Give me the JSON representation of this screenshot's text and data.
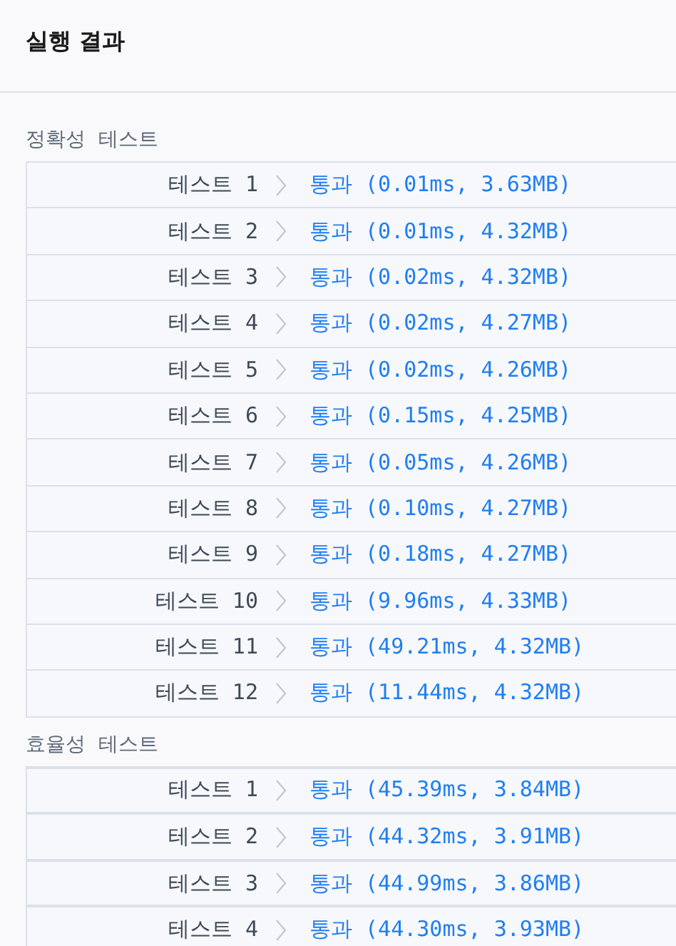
{
  "title": "실행 결과",
  "sections": [
    {
      "label": "정확성  테스트",
      "rows": [
        {
          "label": "테스트 1",
          "result": "통과 (0.01ms, 3.63MB)"
        },
        {
          "label": "테스트 2",
          "result": "통과 (0.01ms, 4.32MB)"
        },
        {
          "label": "테스트 3",
          "result": "통과 (0.02ms, 4.32MB)"
        },
        {
          "label": "테스트 4",
          "result": "통과 (0.02ms, 4.27MB)"
        },
        {
          "label": "테스트 5",
          "result": "통과 (0.02ms, 4.26MB)"
        },
        {
          "label": "테스트 6",
          "result": "통과 (0.15ms, 4.25MB)"
        },
        {
          "label": "테스트 7",
          "result": "통과 (0.05ms, 4.26MB)"
        },
        {
          "label": "테스트 8",
          "result": "통과 (0.10ms, 4.27MB)"
        },
        {
          "label": "테스트 9",
          "result": "통과 (0.18ms, 4.27MB)"
        },
        {
          "label": "테스트 10",
          "result": "통과 (9.96ms, 4.33MB)"
        },
        {
          "label": "테스트 11",
          "result": "통과 (49.21ms, 4.32MB)"
        },
        {
          "label": "테스트 12",
          "result": "통과 (11.44ms, 4.32MB)"
        }
      ]
    },
    {
      "label": "효율성  테스트",
      "rows": [
        {
          "label": "테스트 1",
          "result": "통과 (45.39ms, 3.84MB)"
        },
        {
          "label": "테스트 2",
          "result": "통과 (44.32ms, 3.91MB)"
        },
        {
          "label": "테스트 3",
          "result": "통과 (44.99ms, 3.86MB)"
        },
        {
          "label": "테스트 4",
          "result": "통과 (44.30ms, 3.93MB)"
        }
      ]
    }
  ]
}
